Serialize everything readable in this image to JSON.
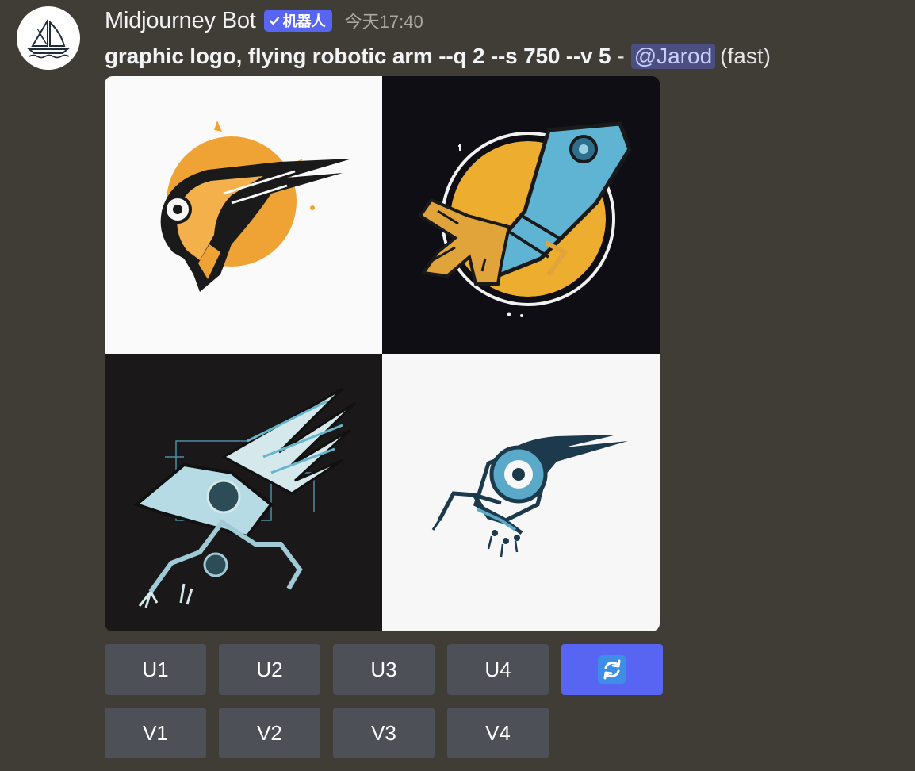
{
  "message": {
    "author": "Midjourney Bot",
    "bot_tag": "机器人",
    "timestamp": "今天17:40",
    "prompt": "graphic logo, flying robotic arm --q 2 --s 750 --v 5",
    "separator": "-",
    "mention": "@Jarod",
    "mode": "(fast)"
  },
  "image_grid": {
    "icons": [
      "sailboat-avatar-icon",
      "robot-helmet-logo",
      "robotic-arm-circle-logo",
      "winged-robotic-arm-logo",
      "robotic-arm-eye-logo"
    ]
  },
  "buttons": {
    "upscale": [
      {
        "label": "U1"
      },
      {
        "label": "U2"
      },
      {
        "label": "U3"
      },
      {
        "label": "U4"
      }
    ],
    "variation": [
      {
        "label": "V1"
      },
      {
        "label": "V2"
      },
      {
        "label": "V3"
      },
      {
        "label": "V4"
      }
    ],
    "reroll_icon": "reroll-icon"
  },
  "colors": {
    "background": "#403d36",
    "blurple": "#5865f2",
    "button_gray": "#4e5058",
    "mention_bg": "#4a4e80",
    "mention_text": "#c9cdfb"
  }
}
